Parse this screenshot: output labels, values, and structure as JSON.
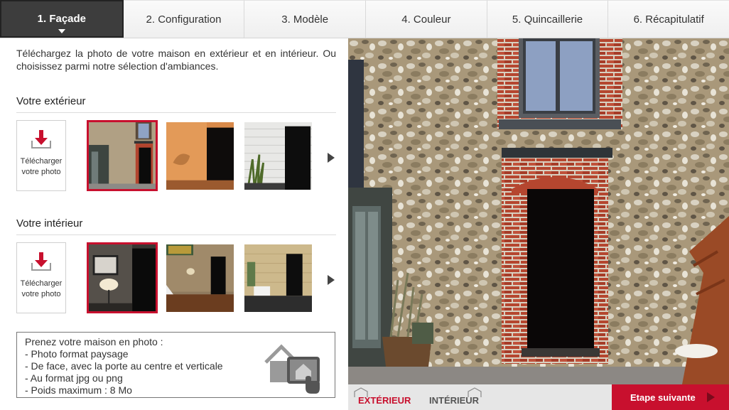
{
  "tabs": [
    {
      "label": "1. Façade",
      "active": true
    },
    {
      "label": "2. Configuration",
      "active": false
    },
    {
      "label": "3. Modèle",
      "active": false
    },
    {
      "label": "4. Couleur",
      "active": false
    },
    {
      "label": "5. Quincaillerie",
      "active": false
    },
    {
      "label": "6. Récapitulatif",
      "active": false
    }
  ],
  "intro": "Téléchargez la photo de votre maison en extérieur et en intérieur. Ou choisissez parmi notre sélection d'ambiances.",
  "exterior": {
    "title": "Votre extérieur",
    "upload_label": "Télécharger votre photo",
    "thumbnails": [
      "stone-facade",
      "orange-wall",
      "white-siding"
    ],
    "selected_index": 0
  },
  "interior": {
    "title": "Votre intérieur",
    "upload_label": "Télécharger votre photo",
    "thumbnails": [
      "living-room-lamp",
      "stone-hall-stairs",
      "wood-hall"
    ],
    "selected_index": 0
  },
  "tips": {
    "title": "Prenez votre maison en photo :",
    "items": [
      "- Photo format paysage",
      "- De face, avec la porte au centre et verticale",
      "- Au format jpg ou png",
      "- Poids maximum : 8 Mo"
    ]
  },
  "view": {
    "exterior_label": "EXTÉRIEUR",
    "interior_label": "INTÉRIEUR",
    "active": "exterior"
  },
  "next_button": "Etape suivante",
  "colors": {
    "accent": "#c8102e",
    "active_tab": "#3d3d3d",
    "tab_bg": "#f4f4f4"
  }
}
